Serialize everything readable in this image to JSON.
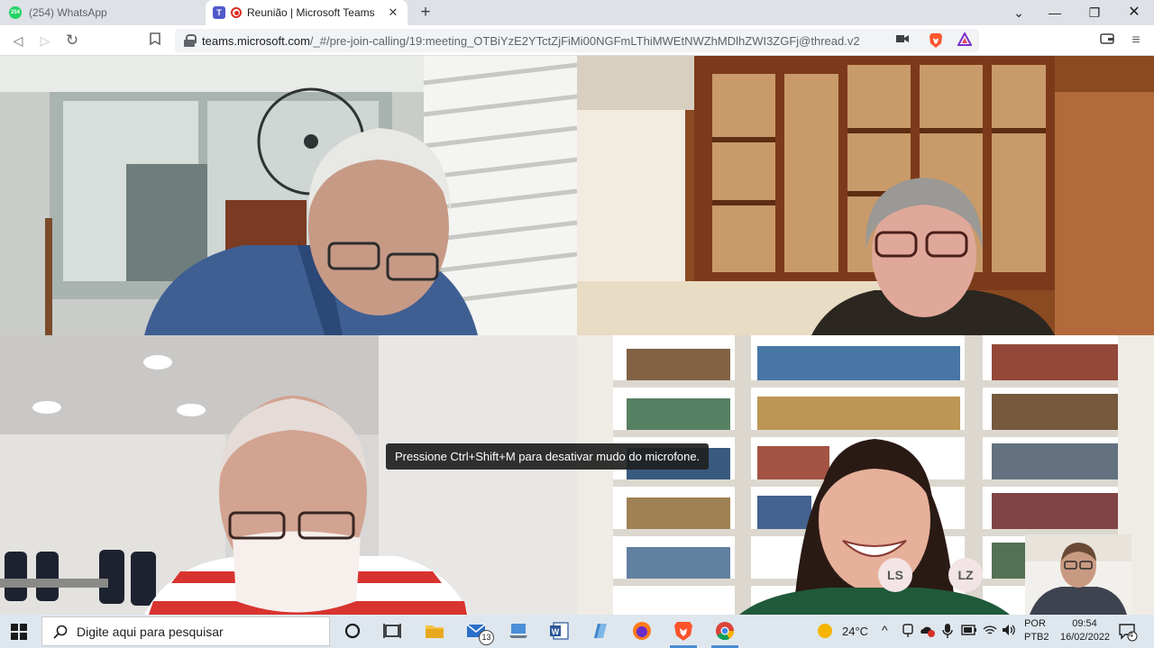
{
  "browser": {
    "tabs": [
      {
        "title": "(254) WhatsApp",
        "favicon": "whatsapp-icon",
        "active": false
      },
      {
        "title": "Reunião | Microsoft Teams",
        "favicon": "teams-icon",
        "active": true,
        "recording": true
      }
    ],
    "favicon_badge": "254",
    "url_host": "teams.microsoft.com",
    "url_path": "/_#/pre-join-calling/19:meeting_OTBiYzE2YTctZjFiMi00NGFmLThiMWEtNWZhMDlhZWI3ZGFj@thread.v2",
    "new_tab_symbol": "+",
    "window_controls": [
      "minimize-icon",
      "restore-icon",
      "close-icon"
    ]
  },
  "meeting": {
    "tooltip": "Pressione Ctrl+Shift+M para desativar mudo do microfone.",
    "participants": [
      {
        "initials": "LS"
      },
      {
        "initials": "LZ"
      }
    ]
  },
  "taskbar": {
    "search_placeholder": "Digite aqui para pesquisar",
    "mail_badge": "13",
    "weather_temp": "24°C",
    "language_line1": "POR",
    "language_line2": "PTB2",
    "time": "09:54",
    "date": "16/02/2022",
    "notification_count": "4"
  },
  "colors": {
    "tab_strip": "#dee1e6",
    "taskbar": "#dfe7ee",
    "teams_purple": "#5059c9",
    "recording_red": "#d93025",
    "brave_orange": "#fb542b"
  }
}
